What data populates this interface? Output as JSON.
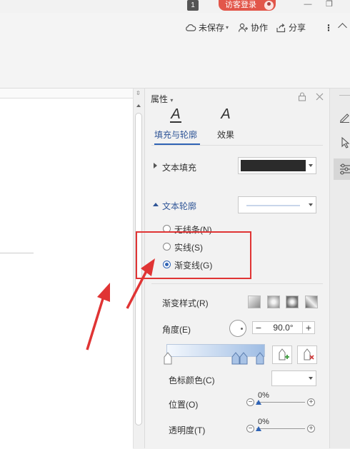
{
  "window": {
    "tab_count": "1",
    "login_label": "访客登录",
    "minimize": "—",
    "restore": "❐"
  },
  "toolbar": {
    "unsaved_label": "未保存",
    "collab_label": "协作",
    "share_label": "分享",
    "more": "⋮"
  },
  "panel": {
    "title": "属性",
    "tabs": [
      {
        "label": "填充与轮廓"
      },
      {
        "label": "效果"
      }
    ],
    "tab_icon_glyph": "A",
    "text_fill": {
      "label": "文本填充",
      "color": "#2b2b2b"
    },
    "text_outline": {
      "label": "文本轮廓"
    },
    "radios": [
      {
        "label": "无线条(N)",
        "selected": false
      },
      {
        "label": "实线(S)",
        "selected": false
      },
      {
        "label": "渐变线(G)",
        "selected": true
      }
    ],
    "gradient_style": {
      "label": "渐变样式(R)"
    },
    "angle": {
      "label": "角度(E)",
      "value": "90.0°",
      "minus": "−",
      "plus": "+"
    },
    "stop_color": {
      "label": "色标颜色(C)"
    },
    "position": {
      "label": "位置(O)",
      "value": "0%"
    },
    "transparency": {
      "label": "透明度(T)",
      "value": "0%"
    }
  },
  "colors": {
    "highlight": "#e03434",
    "accent": "#2f63b5",
    "login_bg": "#e2564a"
  }
}
